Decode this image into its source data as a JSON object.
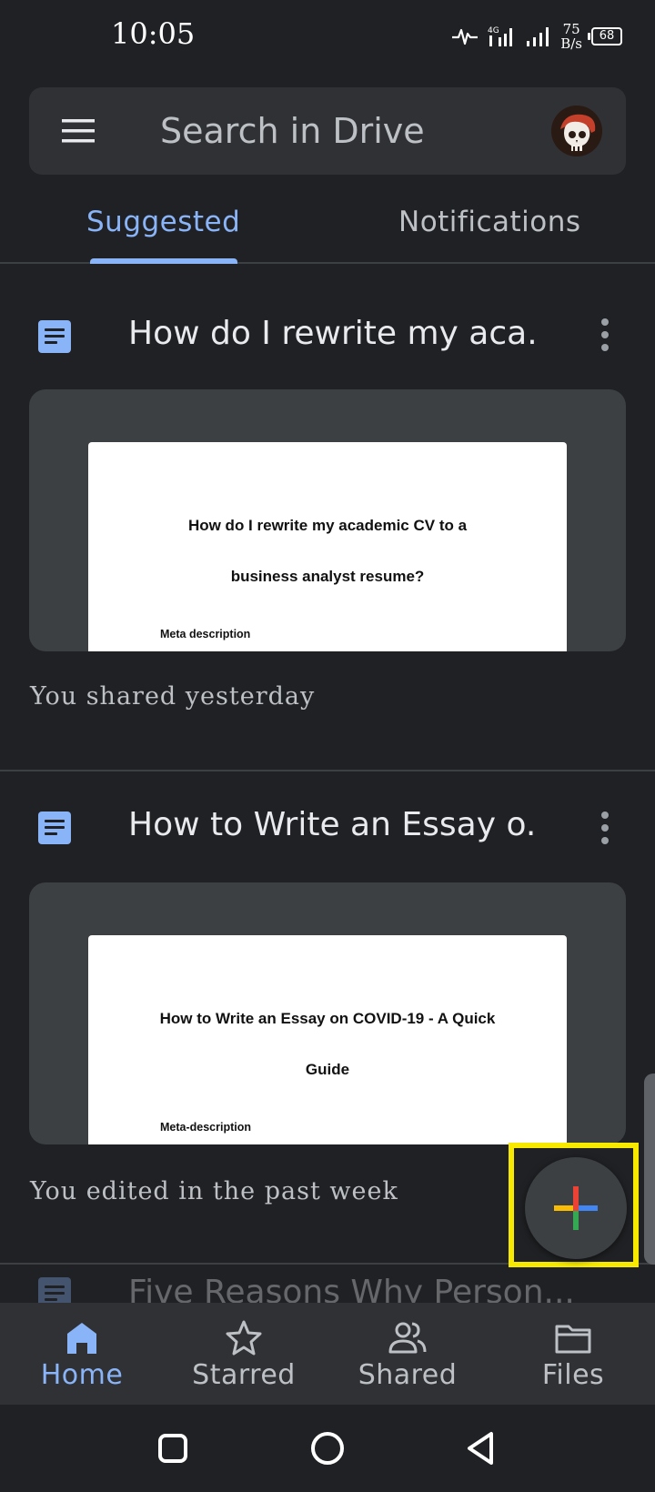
{
  "status_bar": {
    "time": "10:05",
    "network_type": "4G",
    "net_speed_value": "75",
    "net_speed_unit": "B/s",
    "battery": "68"
  },
  "search": {
    "placeholder": "Search in Drive"
  },
  "tabs": [
    {
      "label": "Suggested",
      "active": true
    },
    {
      "label": "Notifications",
      "active": false
    }
  ],
  "files": [
    {
      "title": "How do I rewrite my aca...",
      "preview_heading_line1": "How do I rewrite my academic CV to a",
      "preview_heading_line2": "business analyst resume?",
      "preview_meta": "Meta description",
      "subtitle": "You shared yesterday",
      "icon": "docs-icon"
    },
    {
      "title": "How to Write an Essay o...",
      "preview_heading_line1": "How to Write an Essay on COVID-19 - A Quick",
      "preview_heading_line2": "Guide",
      "preview_meta": "Meta-description",
      "subtitle": "You edited in the past week",
      "icon": "docs-icon"
    },
    {
      "title": "Five Reasons Why Person...",
      "icon": "docs-icon"
    }
  ],
  "fab": {
    "icon": "plus-icon"
  },
  "bottom_nav": [
    {
      "label": "Home",
      "icon": "home-icon",
      "active": true
    },
    {
      "label": "Starred",
      "icon": "star-icon",
      "active": false
    },
    {
      "label": "Shared",
      "icon": "shared-people-icon",
      "active": false
    },
    {
      "label": "Files",
      "icon": "folder-icon",
      "active": false
    }
  ],
  "colors": {
    "background": "#202124",
    "surface": "#303134",
    "accent": "#8ab4f8",
    "highlight": "#f7ea00"
  }
}
